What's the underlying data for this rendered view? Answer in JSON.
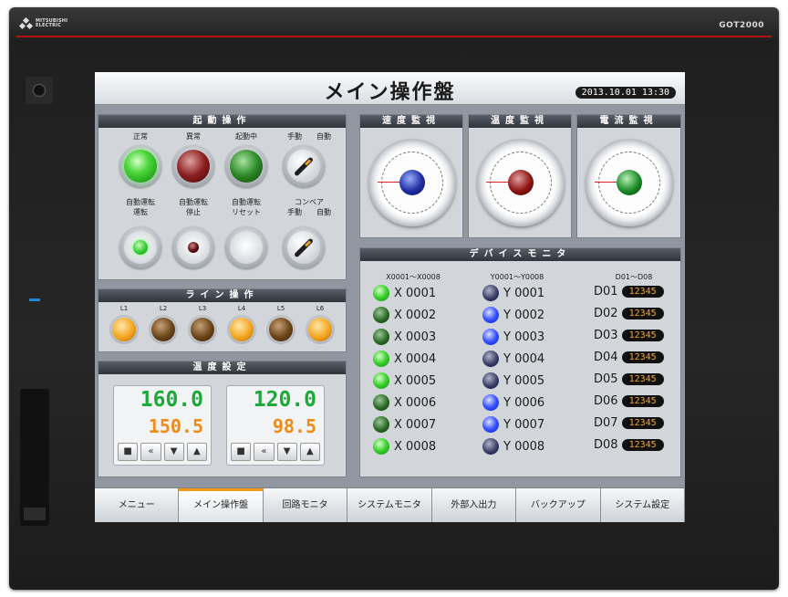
{
  "device": {
    "brand": "MITSUBISHI\nELECTRIC",
    "model": "GOT2000"
  },
  "screen": {
    "title": "メイン操作盤",
    "datetime": "2013.10.01 13:30"
  },
  "start_panel": {
    "title": "起動操作",
    "row1_labels": [
      "正常",
      "異常",
      "起動中",
      "手動　　自動"
    ],
    "row2_labels": [
      "自動運転\n運転",
      "自動運転\n停止",
      "自動運転\nリセット",
      "コンベア\n手動　　自動"
    ]
  },
  "line_panel": {
    "title": "ライン操作",
    "labels": [
      "L1",
      "L2",
      "L3",
      "L4",
      "L5",
      "L6"
    ],
    "states": [
      1,
      0,
      0,
      1,
      0,
      1
    ]
  },
  "temp_panel": {
    "title": "温度設定",
    "boxes": [
      {
        "set": "160.0",
        "current": "150.5"
      },
      {
        "set": "120.0",
        "current": "98.5"
      }
    ],
    "buttons": [
      "■",
      "«",
      "▼",
      "▲"
    ]
  },
  "monitors": [
    {
      "title": "速度監視",
      "color": "#1f2da0"
    },
    {
      "title": "温度監視",
      "color": "#8c1414"
    },
    {
      "title": "電流監視",
      "color": "#1a8a26"
    }
  ],
  "device_monitor": {
    "title": "デバイスモニタ",
    "columns": [
      "X0001～X0008",
      "Y0001～Y0008",
      "D01～D08"
    ],
    "x": [
      "X 0001",
      "X 0002",
      "X 0003",
      "X 0004",
      "X 0005",
      "X 0006",
      "X 0007",
      "X 0008"
    ],
    "x_states": [
      1,
      0,
      0,
      1,
      1,
      0,
      0,
      1
    ],
    "y": [
      "Y 0001",
      "Y 0002",
      "Y 0003",
      "Y 0004",
      "Y 0005",
      "Y 0006",
      "Y 0007",
      "Y 0008"
    ],
    "y_states": [
      0,
      1,
      1,
      0,
      0,
      1,
      1,
      0
    ],
    "d": [
      "D01",
      "D02",
      "D03",
      "D04",
      "D05",
      "D06",
      "D07",
      "D08"
    ],
    "d_value": "12345"
  },
  "tabs": [
    "メニュー",
    "メイン操作盤",
    "回路モニタ",
    "システムモニタ",
    "外部入出力",
    "バックアップ",
    "システム設定"
  ],
  "active_tab": 1
}
